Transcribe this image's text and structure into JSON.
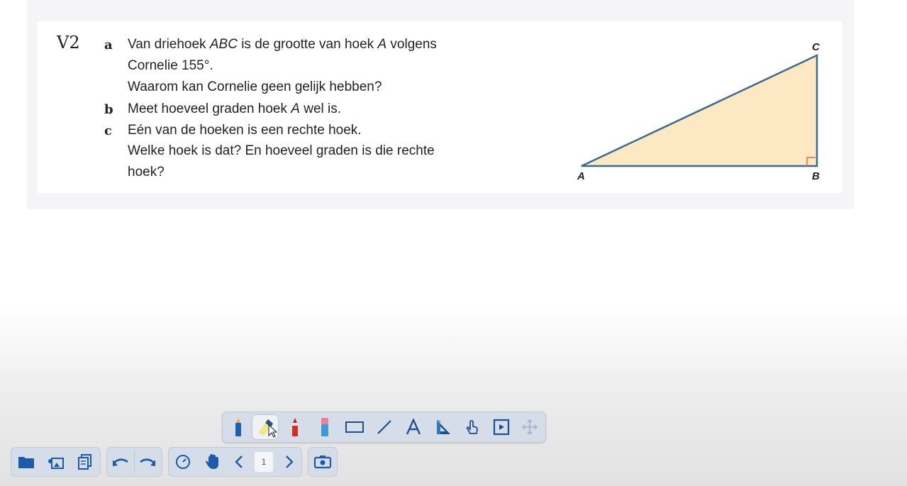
{
  "exercise": {
    "number": "V2",
    "parts": [
      {
        "letter": "a",
        "lines": [
          "Van driehoek ABC is de grootte van hoek A volgens",
          "Cornelie 155°.",
          "Waarom kan Cornelie geen gelijk hebben?"
        ]
      },
      {
        "letter": "b",
        "lines": [
          "Meet hoeveel graden hoek A wel is."
        ]
      },
      {
        "letter": "c",
        "lines": [
          "Eén van de hoeken is een rechte hoek.",
          "Welke hoek is dat? En hoeveel graden is die rechte",
          "hoek?"
        ]
      }
    ],
    "triangle": {
      "vertex_labels": {
        "a": "A",
        "b": "B",
        "c": "C"
      },
      "fill_color": "#fde8c4",
      "stroke_color": "#3b6a93",
      "right_angle_color": "#e46b3b"
    }
  },
  "toolbar": {
    "tools": [
      {
        "name": "pen-tool",
        "icon": "blue-marker-icon"
      },
      {
        "name": "highlighter-tool",
        "icon": "highlighter-icon",
        "active": true
      },
      {
        "name": "red-pen-tool",
        "icon": "red-marker-icon"
      },
      {
        "name": "eraser-tool",
        "icon": "eraser-icon"
      },
      {
        "name": "rectangle-tool",
        "icon": "rectangle-icon"
      },
      {
        "name": "line-tool",
        "icon": "line-icon"
      },
      {
        "name": "text-tool",
        "icon": "text-a-icon"
      },
      {
        "name": "ruler-tool",
        "icon": "set-square-icon"
      },
      {
        "name": "touch-tool",
        "icon": "touch-icon"
      },
      {
        "name": "media-tool",
        "icon": "play-frame-icon"
      },
      {
        "name": "move-toolbar",
        "icon": "move-icon"
      }
    ]
  },
  "bottom_bar": {
    "page_number": "1",
    "accent_color": "#1e5aa8"
  }
}
